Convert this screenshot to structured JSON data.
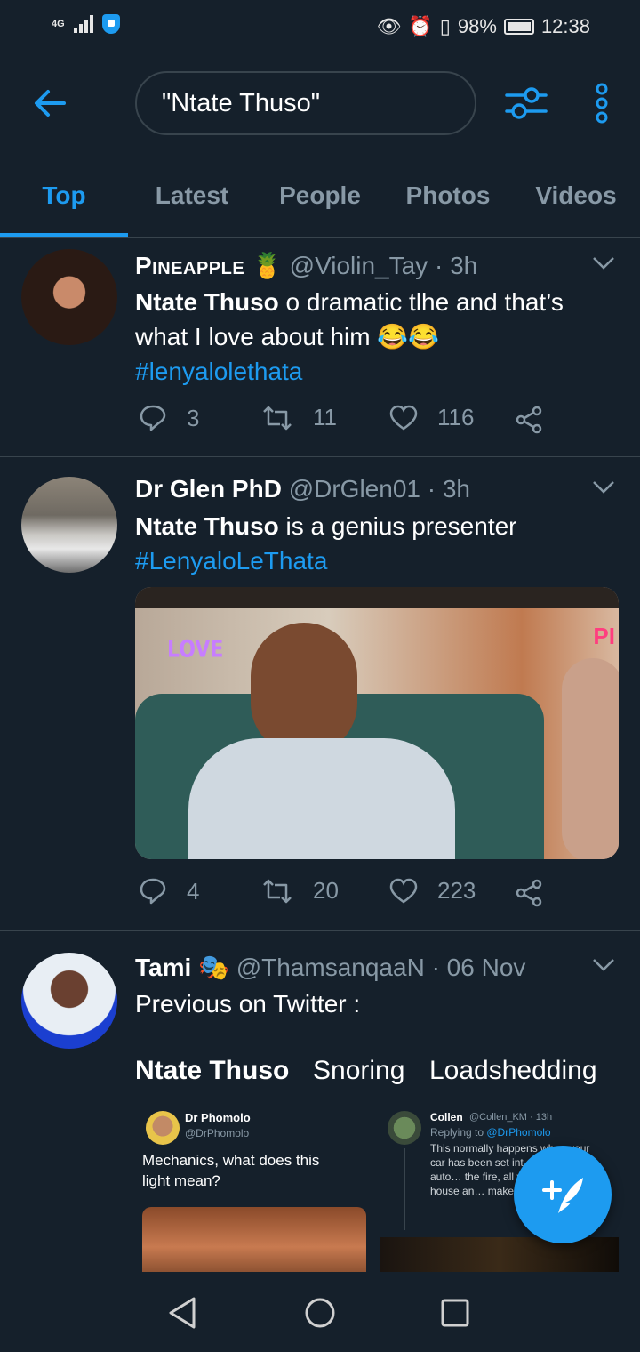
{
  "status_bar": {
    "network": "4G",
    "battery": "98%",
    "time": "12:38"
  },
  "header": {
    "search_value": "\"Ntate Thuso\""
  },
  "tabs": [
    "Top",
    "Latest",
    "People",
    "Photos",
    "Videos"
  ],
  "tweets": [
    {
      "name": "Pineapple",
      "name_emoji": "🍍",
      "handle": "@Violin_Tay",
      "time": "· 3h",
      "text_bold": "Ntate Thuso",
      "text_rest": " o dramatic tlhe and that’s what I love about him ",
      "text_emoji": "😂😂",
      "hashtag": "#lenyalolethata",
      "replies": "3",
      "retweets": "11",
      "likes": "116"
    },
    {
      "name": "Dr Glen PhD",
      "handle": "@DrGlen01",
      "time": "· 3h",
      "text_bold": "Ntate Thuso",
      "text_rest": " is a genius presenter",
      "hashtag": "#LenyaloLeThata",
      "media_text_left": "LOVE",
      "media_text_right": "PI",
      "replies": "4",
      "retweets": "20",
      "likes": "223"
    },
    {
      "name": "Tami",
      "name_emoji": "🎭",
      "handle": "@ThamsanqaaN",
      "time": "· 06 Nov",
      "text": "Previous on Twitter :",
      "labels": [
        "Ntate Thuso",
        "Snoring",
        "Loadshedding"
      ],
      "embed1": {
        "name": "Dr Phomolo",
        "handle": "@DrPhomolo",
        "text": "Mechanics, what does this light mean?"
      },
      "embed2": {
        "name": "Collen",
        "handle_time": "@Collen_KM · 13h",
        "reply_to_prefix": "Replying to ",
        "reply_to": "@DrPhomolo",
        "text": "This normally happens when your car has been set int… then the car auto… the fire, all you h… into the house an… make a braai my si…"
      }
    }
  ],
  "colors": {
    "background": "#15202b",
    "accent": "#1d9bf0",
    "muted": "#8899a6",
    "divider": "#38444d"
  }
}
